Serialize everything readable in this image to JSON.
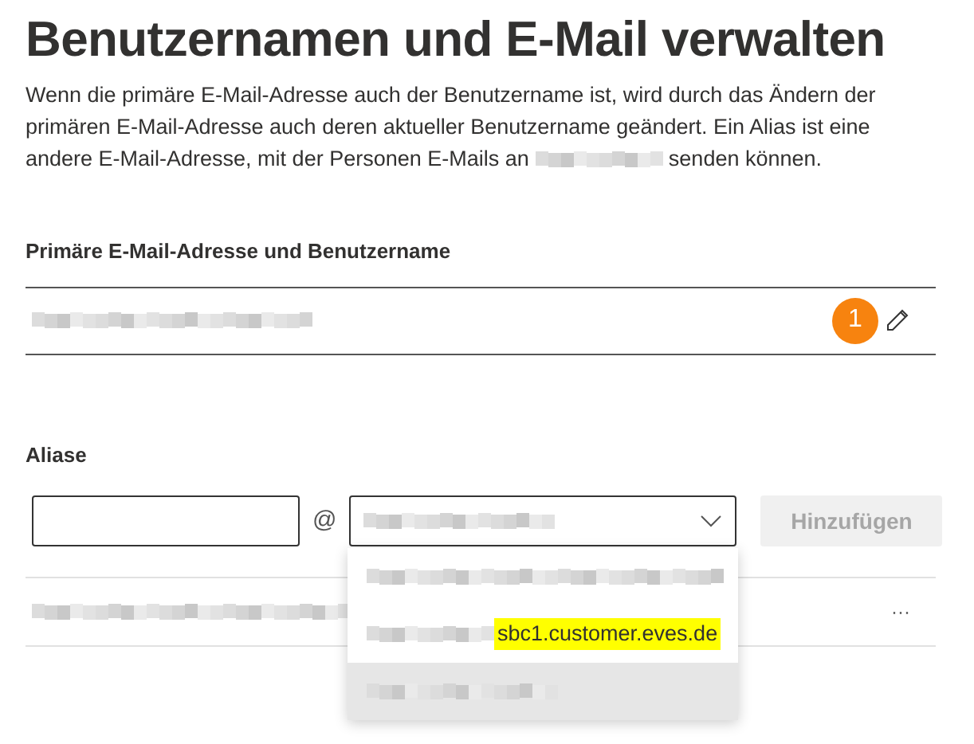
{
  "title": "Benutzernamen und E-Mail verwalten",
  "description": {
    "before": "Wenn die primäre E-Mail-Adresse auch der Benutzername ist, wird durch das Ändern der primären E-Mail-Adresse auch deren aktueller Benutzername geändert. Ein Alias ist eine andere E-Mail-Adresse, mit der Personen E-Mails an",
    "redacted": true,
    "after": "senden können."
  },
  "primary": {
    "label": "Primäre E-Mail-Adresse und Benutzername",
    "value_redacted": true,
    "badge": "1"
  },
  "aliases": {
    "label": "Aliase",
    "at": "@",
    "select_expanded": true,
    "add_button": {
      "label": "Hinzufügen",
      "disabled": true
    },
    "options": [
      {
        "kind": "redacted",
        "selected": false
      },
      {
        "kind": "highlighted",
        "text": "sbc1.customer.eves.de",
        "selected": false
      },
      {
        "kind": "redacted",
        "selected": true
      }
    ],
    "rows": [
      {
        "kind": "redacted",
        "menu": "···"
      }
    ]
  }
}
